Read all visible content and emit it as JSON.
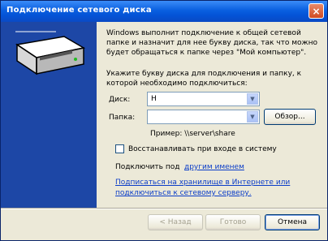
{
  "window": {
    "title": "Подключение сетевого диска",
    "close_label": "×"
  },
  "intro": [
    "Windows выполнит подключение к общей сетевой",
    "папке и назначит для нее букву диска, так что можно",
    "будет обращаться к папке через \"Мой компьютер\"."
  ],
  "instruction": [
    "Укажите букву диска для подключения и папку, к",
    "которой необходимо подключиться:"
  ],
  "drive": {
    "label": "Диск:",
    "value": "H"
  },
  "folder": {
    "label": "Папка:",
    "value": "",
    "browse_label": "Обзор..."
  },
  "example": "Пример: \\\\server\\share",
  "reconnect": {
    "label": "Восстанавливать при входе в систему",
    "checked": false
  },
  "alt_credentials": {
    "prefix": "Подключить под",
    "link": "другим именем"
  },
  "storage_link": [
    "Подписаться на хранилище в Интернете или",
    "подключиться к сетевому серверу."
  ],
  "footer": {
    "back_label": "< Назад",
    "finish_label": "Готово",
    "cancel_label": "Отмена"
  },
  "icons": {
    "banner": "network-drive-icon",
    "close": "close-icon",
    "dropdown": "chevron-down-icon"
  }
}
